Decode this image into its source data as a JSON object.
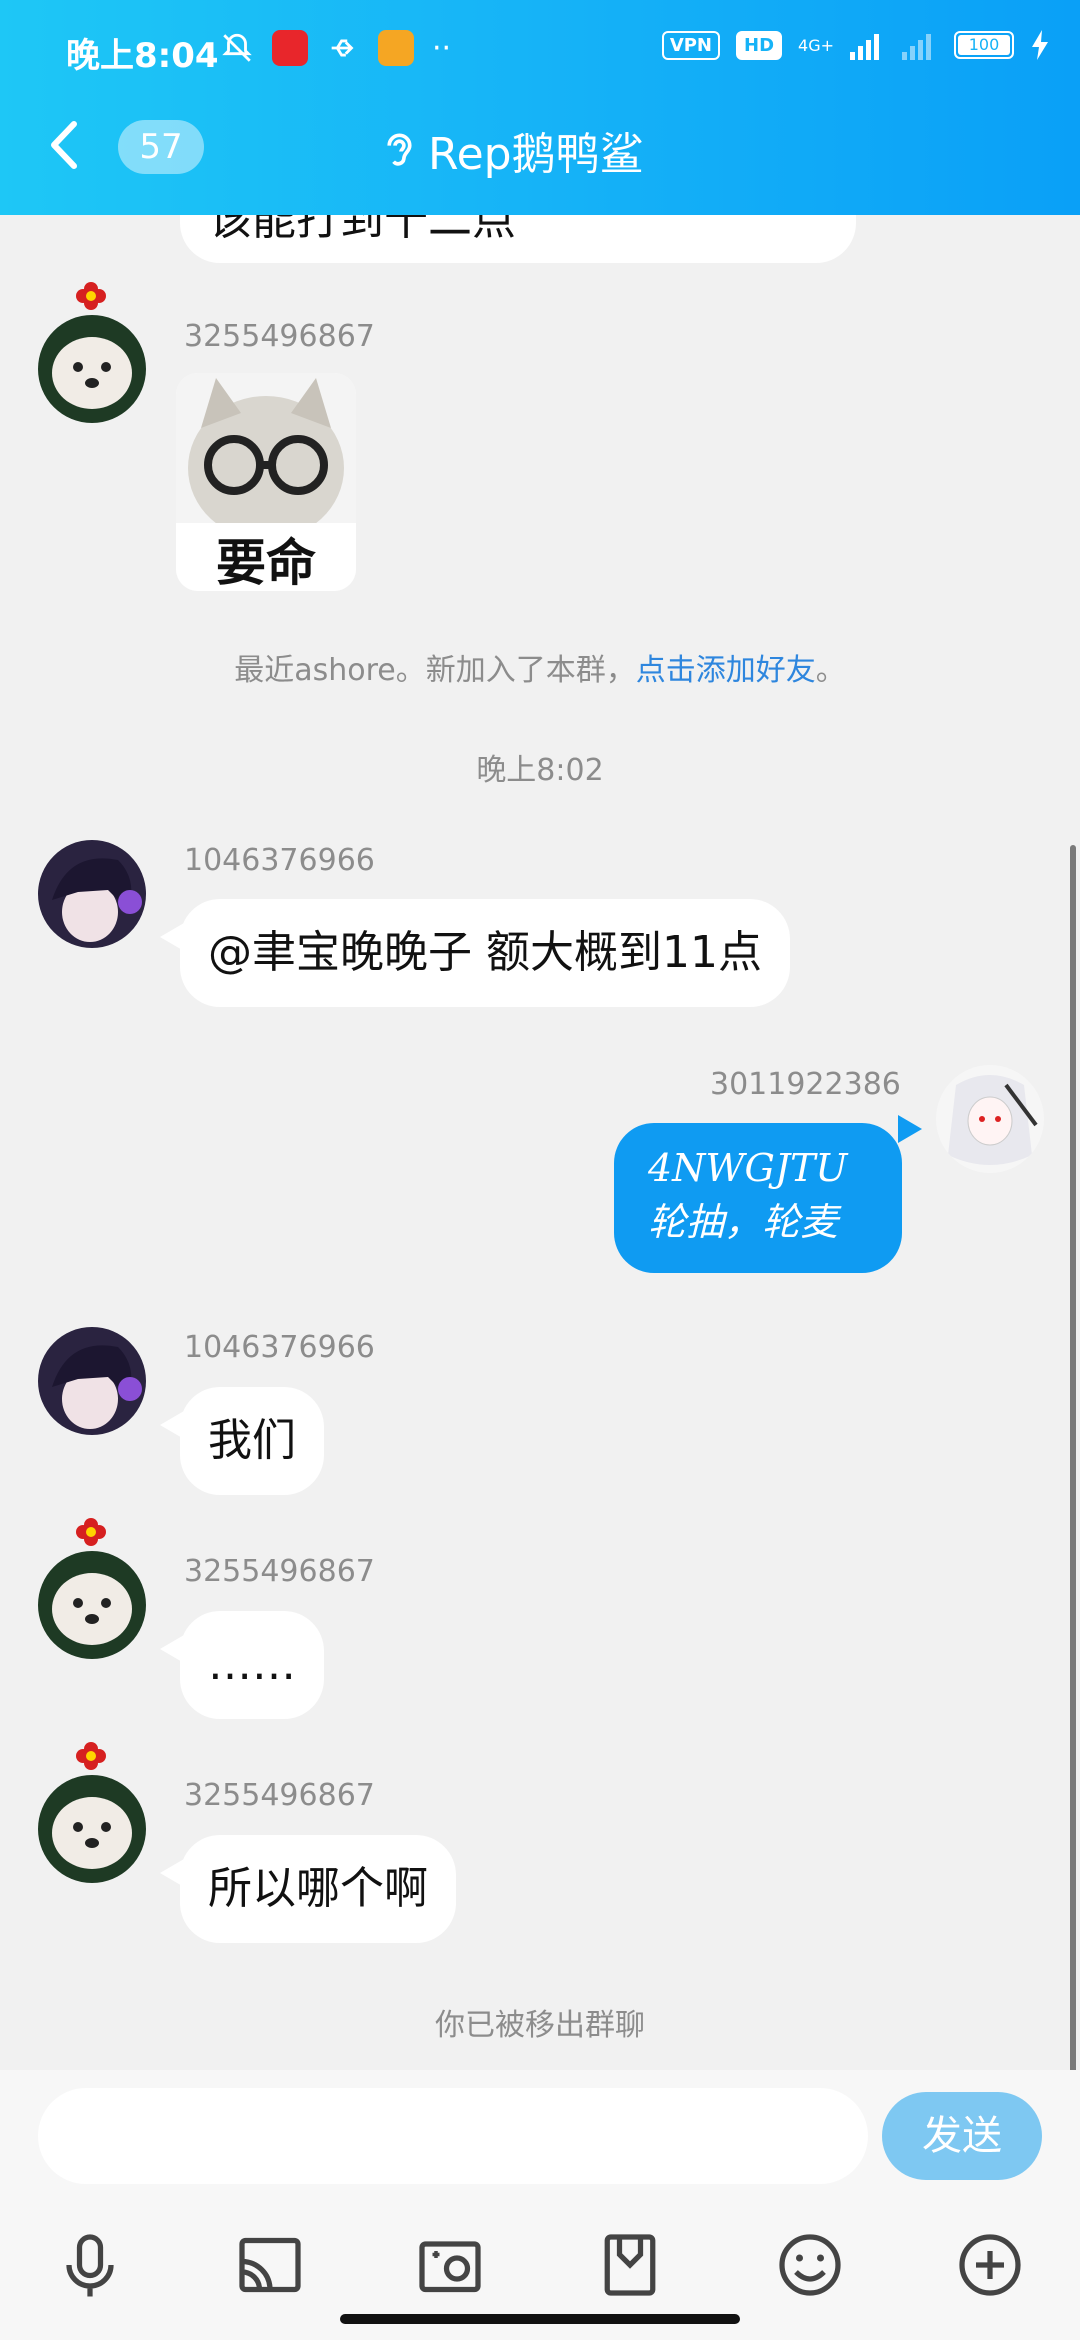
{
  "status_bar": {
    "time": "晚上8:04",
    "vpn": "VPN",
    "hd": "HD",
    "network": "4G+",
    "battery": "100"
  },
  "header": {
    "back_badge": "57",
    "title": "Rep鹅鸭鲨"
  },
  "messages": {
    "partial_top_text": "该能打到十二点",
    "m1_sender": "3255496867",
    "m1_sticker_text": "要命",
    "system_join": "最近ashore。新加入了本群，",
    "system_join_link": "点击添加好友",
    "system_join_end": "。",
    "timestamp": "晚上8:02",
    "m2_sender": "1046376966",
    "m2_text": "@聿宝晚晚子 额大概到11点",
    "m3_sender": "3011922386",
    "m3_line1": "4NWGJTU",
    "m3_line2": "轮抽，轮麦",
    "m4_sender": "1046376966",
    "m4_text": "我们",
    "m5_sender": "3255496867",
    "m5_text": "……",
    "m6_sender": "3255496867",
    "m6_text": "所以哪个啊",
    "system_removed": "你已被移出群聊"
  },
  "input_bar": {
    "placeholder": "",
    "send_label": "发送"
  },
  "toolbar": [
    "mic-icon",
    "cast-icon",
    "photo-icon",
    "file-icon",
    "emoji-icon",
    "plus-icon"
  ]
}
